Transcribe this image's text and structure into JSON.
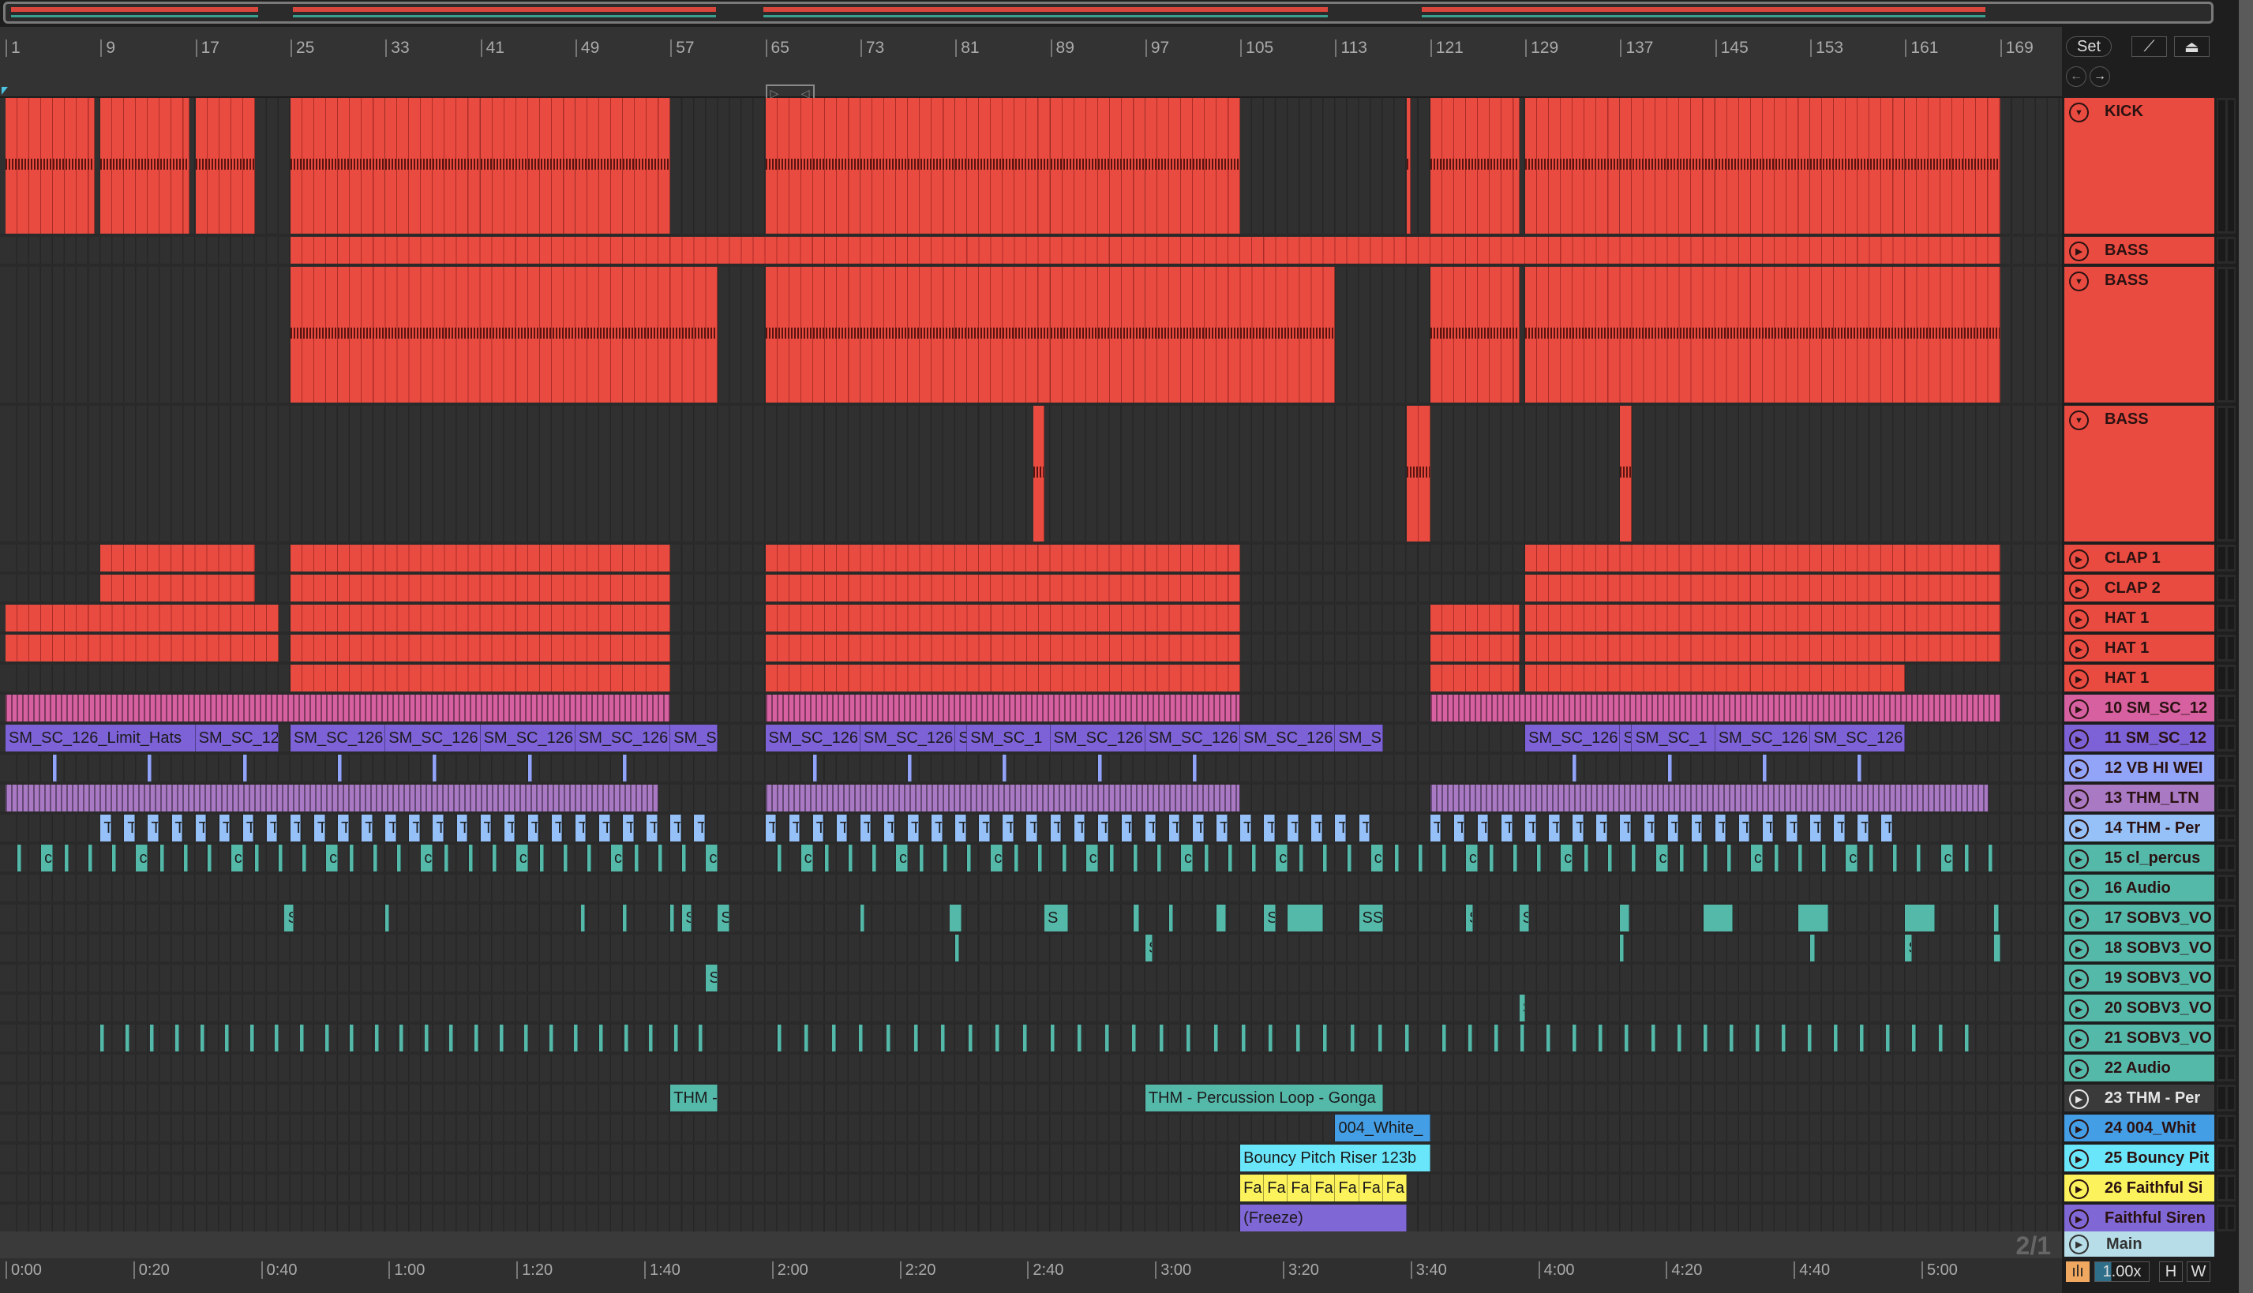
{
  "ruler": {
    "bars": [
      "1",
      "9",
      "17",
      "25",
      "33",
      "41",
      "49",
      "57",
      "65",
      "73",
      "81",
      "89",
      "97",
      "105",
      "113",
      "121",
      "129",
      "137",
      "145",
      "153",
      "161",
      "169"
    ]
  },
  "timeline": {
    "labels": [
      "0:00",
      "0:20",
      "0:40",
      "1:00",
      "1:20",
      "1:40",
      "2:00",
      "2:20",
      "2:40",
      "3:00",
      "3:20",
      "3:40",
      "4:00",
      "4:20",
      "4:40",
      "5:00"
    ]
  },
  "controls": {
    "set": "Set",
    "zoom": "1.00x",
    "h": "H",
    "w": "W",
    "signature": "2/1"
  },
  "main": {
    "label": "Main",
    "color": "#b7dde8"
  },
  "tracks": [
    {
      "name": "KICK",
      "size": "tall",
      "color": "#ea4b40",
      "kind": "red",
      "expanded": true,
      "clips": [
        [
          1,
          8.5
        ],
        [
          9,
          16.5
        ],
        [
          17,
          22
        ],
        [
          25,
          33
        ],
        [
          33,
          41
        ],
        [
          41,
          49
        ],
        [
          49,
          57
        ],
        [
          65,
          73
        ],
        [
          73,
          81
        ],
        [
          81,
          89
        ],
        [
          89,
          97
        ],
        [
          97,
          105
        ],
        [
          119,
          119.2
        ],
        [
          121,
          128.5
        ],
        [
          129,
          137
        ],
        [
          137,
          145
        ],
        [
          145,
          153
        ],
        [
          153,
          161
        ],
        [
          161,
          169
        ]
      ]
    },
    {
      "name": "BASS",
      "size": "small",
      "color": "#ea4b40",
      "kind": "red",
      "clips": [
        [
          25,
          169
        ]
      ]
    },
    {
      "name": "BASS",
      "size": "tall",
      "color": "#ea4b40",
      "kind": "red",
      "expanded": true,
      "clips": [
        [
          25,
          61
        ],
        [
          65,
          73
        ],
        [
          73,
          81
        ],
        [
          81,
          89
        ],
        [
          89,
          97
        ],
        [
          97,
          113
        ],
        [
          121,
          128.5
        ],
        [
          129,
          169
        ]
      ]
    },
    {
      "name": "BASS",
      "size": "tall",
      "color": "#ea4b40",
      "kind": "red",
      "expanded": true,
      "clips": [
        [
          87.6,
          88.5
        ],
        [
          119,
          121
        ],
        [
          137,
          138
        ]
      ]
    },
    {
      "name": "CLAP 1",
      "size": "small",
      "color": "#ea4b40",
      "kind": "red",
      "clips": [
        [
          9,
          22
        ],
        [
          25,
          57
        ],
        [
          65,
          81
        ],
        [
          81,
          97
        ],
        [
          97,
          105
        ],
        [
          129,
          169
        ]
      ]
    },
    {
      "name": "CLAP 2",
      "size": "small",
      "color": "#ea4b40",
      "kind": "red",
      "clips": [
        [
          9,
          22
        ],
        [
          25,
          57
        ],
        [
          65,
          81
        ],
        [
          81,
          97
        ],
        [
          97,
          105
        ],
        [
          129,
          169
        ]
      ]
    },
    {
      "name": "HAT 1",
      "size": "small",
      "color": "#ea4b40",
      "kind": "red",
      "clips": [
        [
          1,
          24
        ],
        [
          25,
          57
        ],
        [
          65,
          105
        ],
        [
          121,
          128.5
        ],
        [
          129,
          169
        ]
      ]
    },
    {
      "name": "HAT 1",
      "size": "small",
      "color": "#ea4b40",
      "kind": "red",
      "clips": [
        [
          1,
          24
        ],
        [
          25,
          57
        ],
        [
          65,
          105
        ],
        [
          121,
          128.5
        ],
        [
          129,
          169
        ]
      ]
    },
    {
      "name": "HAT 1",
      "size": "small",
      "color": "#ea4b40",
      "kind": "red",
      "clips": [
        [
          25,
          57
        ],
        [
          65,
          105
        ],
        [
          121,
          128.5
        ],
        [
          129,
          161
        ]
      ]
    },
    {
      "name": "10 SM_SC_12",
      "size": "small",
      "color": "#d660a0",
      "kind": "stripe",
      "clips": [
        [
          1,
          57
        ],
        [
          65,
          105
        ],
        [
          121,
          169
        ]
      ]
    },
    {
      "name": "11 SM_SC_12",
      "size": "small",
      "color": "#7d62d7",
      "clips": [
        [
          1,
          17,
          "SM_SC_126_Limit_Hats"
        ],
        [
          17,
          24,
          "SM_SC_12"
        ],
        [
          25,
          33,
          "SM_SC_126"
        ],
        [
          33,
          41,
          "SM_SC_126"
        ],
        [
          41,
          49,
          "SM_SC_126"
        ],
        [
          49,
          57,
          "SM_SC_126"
        ],
        [
          57,
          61,
          "SM_S"
        ],
        [
          65,
          73,
          "SM_SC_126"
        ],
        [
          73,
          81,
          "SM_SC_126"
        ],
        [
          81,
          82,
          "S"
        ],
        [
          82,
          89,
          "SM_SC_1"
        ],
        [
          89,
          97,
          "SM_SC_126"
        ],
        [
          97,
          105,
          "SM_SC_126"
        ],
        [
          105,
          113,
          "SM_SC_126"
        ],
        [
          113,
          117,
          "SM_S"
        ],
        [
          129,
          137,
          "SM_SC_126"
        ],
        [
          137,
          138,
          "S"
        ],
        [
          138,
          145,
          "SM_SC_1"
        ],
        [
          145,
          153,
          "SM_SC_126"
        ],
        [
          153,
          161,
          "SM_SC_126"
        ]
      ]
    },
    {
      "name": "12 VB HI WEI",
      "size": "small",
      "color": "#92a4f8",
      "patterns": [
        {
          "from": 5,
          "to": 61,
          "every": 8,
          "len": 0.3
        },
        {
          "from": 69,
          "to": 105,
          "every": 8,
          "len": 0.3
        },
        {
          "from": 133,
          "to": 165,
          "every": 8,
          "len": 0.3
        }
      ]
    },
    {
      "name": "13 THM_LTN",
      "size": "small",
      "color": "#a979c4",
      "kind": "stripe",
      "clips": [
        [
          1,
          56
        ],
        [
          65,
          105
        ],
        [
          121,
          168
        ]
      ]
    },
    {
      "name": "14 THM - Per",
      "size": "small",
      "color": "#96c1f8",
      "patterns": [
        {
          "from": 9,
          "to": 61,
          "every": 2,
          "len": 0.9,
          "label": "T"
        },
        {
          "from": 65,
          "to": 117,
          "every": 2,
          "len": 0.9,
          "label": "T"
        },
        {
          "from": 121,
          "to": 161,
          "every": 2,
          "len": 0.9,
          "label": "T"
        }
      ]
    },
    {
      "name": "15 cl_percus",
      "size": "small",
      "color": "#55b9aa",
      "patterns": [
        {
          "from": 2,
          "to": 61,
          "every": 2,
          "len": 0.25
        },
        {
          "from": 4,
          "to": 61,
          "every": 8,
          "len": 1,
          "label": "c"
        },
        {
          "from": 66,
          "to": 121,
          "every": 2,
          "len": 0.25
        },
        {
          "from": 68,
          "to": 121,
          "every": 8,
          "len": 1,
          "label": "c"
        },
        {
          "from": 122,
          "to": 169,
          "every": 2,
          "len": 0.25
        },
        {
          "from": 124,
          "to": 169,
          "every": 8,
          "len": 1,
          "label": "c"
        }
      ]
    },
    {
      "name": "16 Audio",
      "size": "small",
      "color": "#55b9aa",
      "clips": []
    },
    {
      "name": "17 SOBV3_VO",
      "size": "small",
      "color": "#55b9aa",
      "clips": [
        [
          24.5,
          25.3,
          "S"
        ],
        [
          33,
          33.3
        ],
        [
          49.5,
          49.8
        ],
        [
          53,
          53.3
        ],
        [
          57,
          57.3
        ],
        [
          58,
          58.8,
          "S"
        ],
        [
          61,
          62,
          "S"
        ],
        [
          73,
          73.3
        ],
        [
          80.5,
          81.5
        ],
        [
          88.5,
          90.5,
          "S"
        ],
        [
          96,
          96.5
        ],
        [
          99,
          99.3
        ],
        [
          103,
          103.8
        ],
        [
          107,
          108,
          "S"
        ],
        [
          109,
          112
        ],
        [
          115,
          117,
          "SSS"
        ],
        [
          124,
          124.6,
          "S"
        ],
        [
          128.5,
          129.3,
          "S"
        ],
        [
          137,
          137.8
        ],
        [
          144,
          146.5
        ],
        [
          152,
          154.5
        ],
        [
          161,
          163.5
        ],
        [
          168.5,
          168.9
        ]
      ]
    },
    {
      "name": "18 SOBV3_VO",
      "size": "small",
      "color": "#55b9aa",
      "clips": [
        [
          81,
          81.3
        ],
        [
          97,
          97.6,
          "S"
        ],
        [
          137,
          137.3
        ],
        [
          153,
          153.4
        ],
        [
          161,
          161.6,
          "S"
        ],
        [
          168.5,
          169
        ]
      ]
    },
    {
      "name": "19 SOBV3_VO",
      "size": "small",
      "color": "#55b9aa",
      "clips": [
        [
          60,
          61,
          "S"
        ]
      ]
    },
    {
      "name": "20 SOBV3_VO",
      "size": "small",
      "color": "#55b9aa",
      "clips": [
        [
          128.5,
          129,
          "S"
        ]
      ]
    },
    {
      "name": "21 SOBV3_VO",
      "size": "small",
      "color": "#55b9aa",
      "patterns": [
        {
          "from": 9,
          "to": 61,
          "every": 2.1,
          "len": 0.2
        },
        {
          "from": 66,
          "to": 120,
          "every": 2.3,
          "len": 0.2
        },
        {
          "from": 122,
          "to": 167,
          "every": 2.2,
          "len": 0.2
        }
      ]
    },
    {
      "name": "22 Audio",
      "size": "small",
      "color": "#55b9aa",
      "clips": []
    },
    {
      "name": "23 THM - Per",
      "size": "small",
      "color": "#3a3a3a",
      "headerText": "#e6e6e6",
      "clipColor": "#55b9aa",
      "clips": [
        [
          57,
          61,
          "THM -"
        ],
        [
          97,
          117,
          "THM - Percussion Loop - Gonga"
        ]
      ]
    },
    {
      "name": "24 004_Whit",
      "size": "small",
      "color": "#449ee6",
      "clips": [
        [
          113,
          121,
          "004_White_"
        ]
      ]
    },
    {
      "name": "25 Bouncy Pit",
      "size": "small",
      "color": "#6ae6fa",
      "clips": [
        [
          105,
          121,
          "Bouncy Pitch Riser 123b"
        ]
      ]
    },
    {
      "name": "26 Faithful Si",
      "size": "small",
      "color": "#fcf35c",
      "clips": [
        [
          105,
          107,
          "Fa"
        ],
        [
          107,
          109,
          "Fa"
        ],
        [
          109,
          111,
          "Fa"
        ],
        [
          111,
          113,
          "Fa"
        ],
        [
          113,
          115,
          "Fa"
        ],
        [
          115,
          117,
          "Fa"
        ],
        [
          117,
          119,
          "Fa"
        ]
      ]
    },
    {
      "name": "Faithful Siren",
      "size": "small",
      "color": "#8067d6",
      "clips": [
        [
          105,
          119,
          "(Freeze)"
        ]
      ]
    }
  ]
}
